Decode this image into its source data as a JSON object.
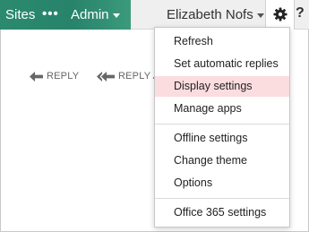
{
  "topbar": {
    "brand": {
      "sites_label": "Sites",
      "more_label": "•••",
      "admin_label": "Admin",
      "background": "#2b8a6e"
    },
    "user": {
      "name": "Elizabeth Nofs"
    },
    "settings_icon": "gear-icon",
    "help_label": "?"
  },
  "actions": {
    "reply_label": "REPLY",
    "reply_all_label": "REPLY ALL"
  },
  "menu": {
    "items": [
      {
        "label": "Refresh"
      },
      {
        "label": "Set automatic replies"
      },
      {
        "label": "Display settings",
        "highlighted": true
      },
      {
        "label": "Manage apps"
      },
      {
        "label": "Offline settings"
      },
      {
        "label": "Change theme"
      },
      {
        "label": "Options"
      },
      {
        "label": "Office 365 settings"
      }
    ],
    "highlight_color": "#fbdcdf"
  }
}
